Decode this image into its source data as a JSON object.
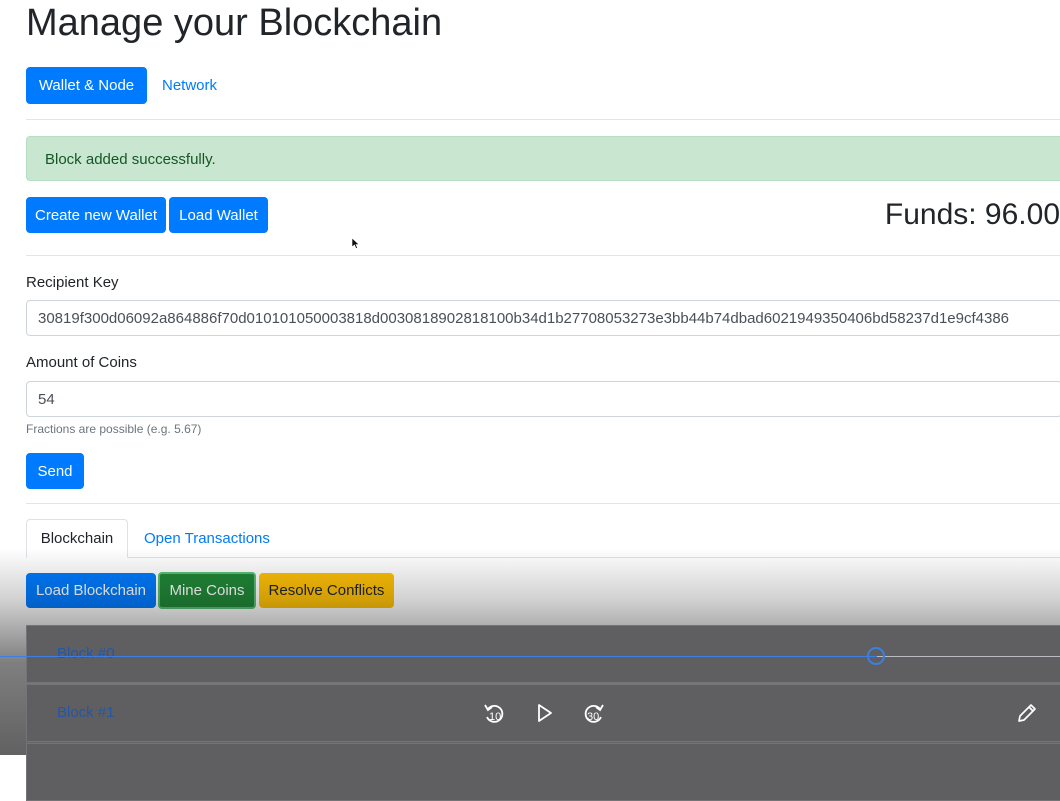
{
  "page": {
    "title": "Manage your Blockchain"
  },
  "nav": {
    "tabs": [
      {
        "label": "Wallet & Node"
      },
      {
        "label": "Network"
      }
    ]
  },
  "alert": {
    "message": "Block added successfully."
  },
  "wallet": {
    "create_label": "Create new Wallet",
    "load_label": "Load Wallet",
    "funds_text": "Funds: 96.00"
  },
  "form": {
    "recipient_label": "Recipient Key",
    "recipient_value": "30819f300d06092a864886f70d010101050003818d0030818902818100b34d1b27708053273e3bb44b74dbad6021949350406bd58237d1e9cf4386",
    "amount_label": "Amount of Coins",
    "amount_value": "54",
    "helper_text": "Fractions are possible (e.g. 5.67)",
    "send_label": "Send"
  },
  "lower_tabs": [
    {
      "label": "Blockchain"
    },
    {
      "label": "Open Transactions"
    }
  ],
  "actions": {
    "load_blockchain": "Load Blockchain",
    "mine_coins": "Mine Coins",
    "resolve_conflicts": "Resolve Conflicts"
  },
  "blocks": [
    {
      "label": "Block #0"
    },
    {
      "label": "Block #1"
    }
  ],
  "player": {
    "rewind_seconds": "10",
    "forward_seconds": "30",
    "progress": 0.83,
    "accent_color": "#3c7fe0",
    "icons": [
      "rewind-10-icon",
      "play-icon",
      "forward-30-icon",
      "pencil-icon"
    ]
  },
  "colors": {
    "primary": "#007bff",
    "success": "#218838",
    "warning": "#ffc107",
    "alert_bg": "#c8e6d0"
  }
}
